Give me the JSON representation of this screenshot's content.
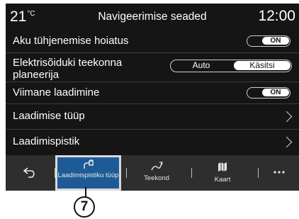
{
  "header": {
    "temperature": "21",
    "temperature_unit": "°C",
    "title": "Navigeerimise seaded",
    "clock": "12:00"
  },
  "settings": {
    "battery_warning": {
      "label": "Aku tühjenemise hoiatus",
      "toggle": "ON"
    },
    "ev_planner": {
      "label": "Elektrisõiduki teekonna planeerija",
      "options": [
        "Auto",
        "Käsitsi"
      ],
      "selected": "Käsitsi"
    },
    "last_charging": {
      "label": "Viimane laadimine",
      "toggle": "ON"
    },
    "charging_type": {
      "label": "Laadimise tüüp"
    },
    "charging_station": {
      "label": "Laadimispistik"
    }
  },
  "tabbar": {
    "back_icon": "back-arrow-icon",
    "tabs": [
      {
        "label": "Laadimispistiku tüüp",
        "icon": "charging-plug-icon",
        "active": true
      },
      {
        "label": "Teekond",
        "icon": "route-icon",
        "active": false
      },
      {
        "label": "Kaart",
        "icon": "map-icon",
        "active": false
      }
    ],
    "more_icon": "more-dots-icon"
  },
  "callout": {
    "number": "7"
  },
  "colors": {
    "background": "#151515",
    "tab_active": "#1e5b96",
    "tabbar": "#2e2e2e"
  }
}
